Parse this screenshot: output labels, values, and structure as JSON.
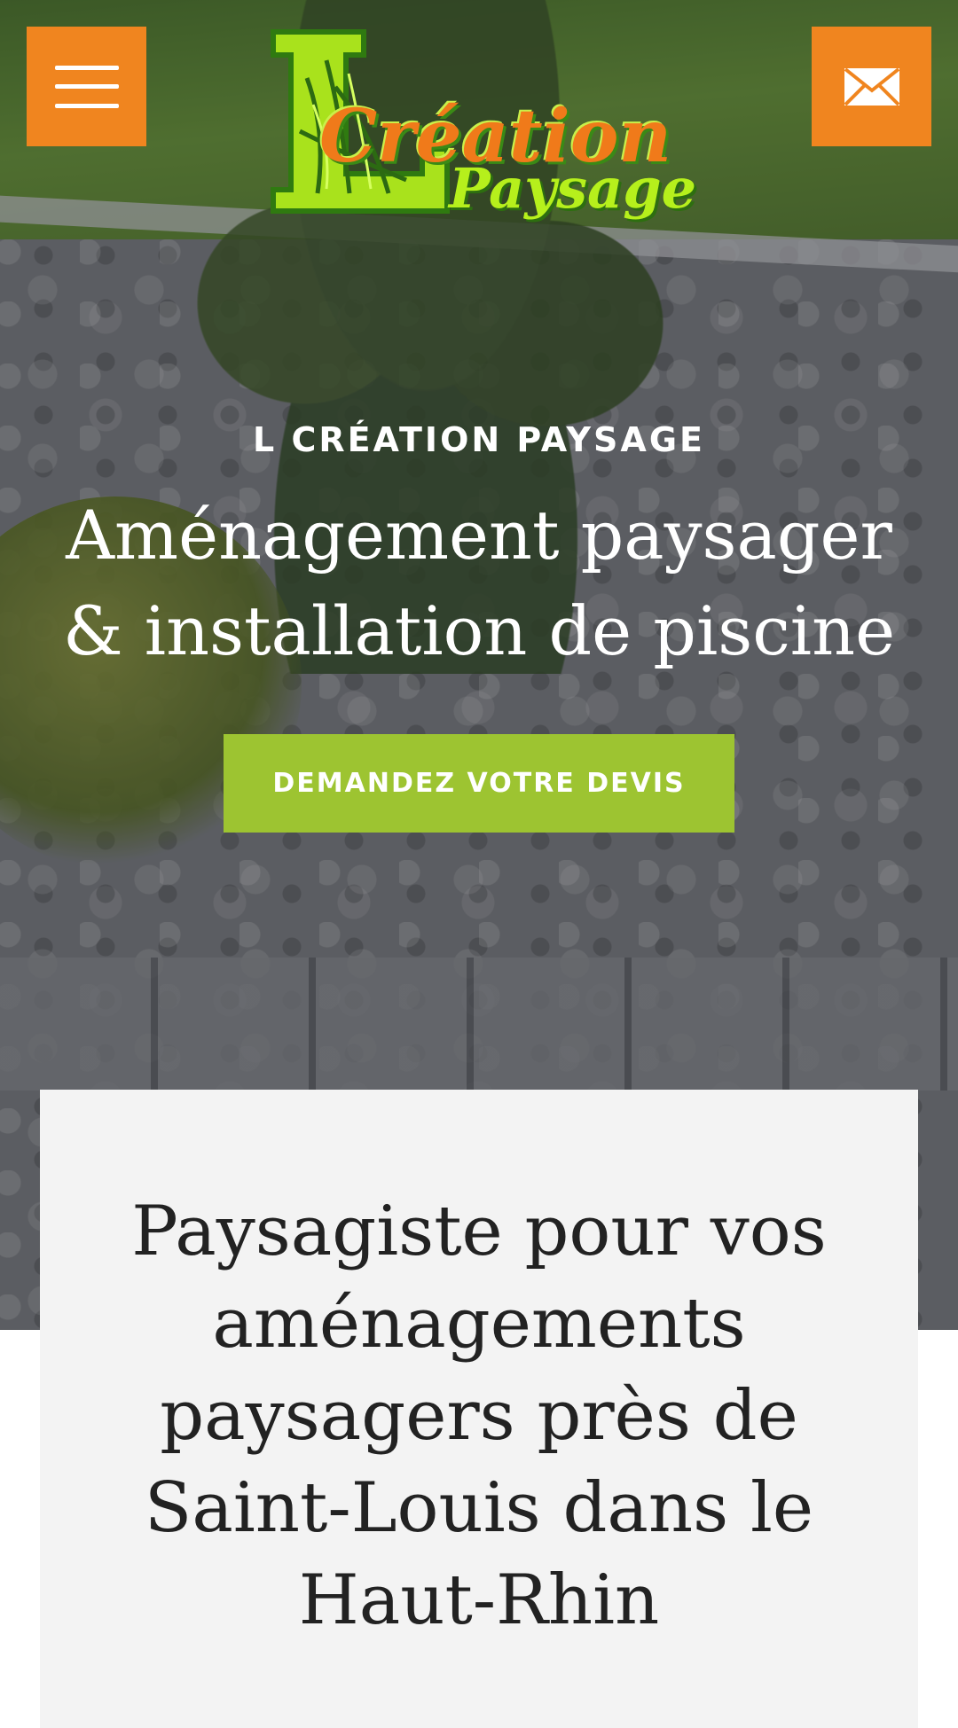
{
  "header": {
    "menu_icon": "hamburger-menu-icon",
    "mail_icon": "envelope-icon",
    "logo": {
      "line1": "Création",
      "line2": "Paysage",
      "letter": "L"
    }
  },
  "hero": {
    "eyebrow": "L CRÉATION PAYSAGE",
    "title": "Aménagement paysager & installation de piscine",
    "cta_label": "DEMANDEZ VOTRE DEVIS"
  },
  "intro": {
    "title": "Paysagiste pour vos aménagements paysagers près de Saint-Louis dans le Haut-Rhin"
  },
  "colors": {
    "accent_orange": "#f0851f",
    "accent_green": "#9dc431",
    "logo_orange": "#f07a1a",
    "logo_lime": "#b6f01c",
    "card_bg": "#f3f3f3",
    "text_dark": "#222222"
  }
}
